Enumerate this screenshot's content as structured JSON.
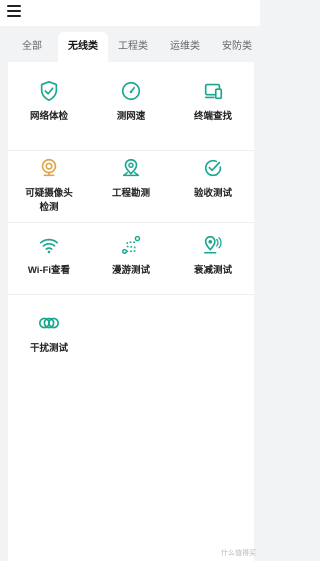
{
  "tabs": [
    {
      "label": "全部",
      "active": false
    },
    {
      "label": "无线类",
      "active": true
    },
    {
      "label": "工程类",
      "active": false
    },
    {
      "label": "运维类",
      "active": false
    },
    {
      "label": "安防类",
      "active": false
    }
  ],
  "tools": [
    {
      "label": "网络体检",
      "icon": "shield-check-icon"
    },
    {
      "label": "测网速",
      "icon": "speedometer-icon"
    },
    {
      "label": "终端查找",
      "icon": "devices-icon"
    },
    {
      "label": "可疑摄像头检测",
      "label_line1": "可疑摄像头",
      "label_line2": "检测",
      "icon": "camera-icon"
    },
    {
      "label": "工程勘测",
      "icon": "map-pin-icon"
    },
    {
      "label": "验收测试",
      "icon": "check-circle-icon"
    },
    {
      "label": "Wi-Fi查看",
      "icon": "wifi-icon"
    },
    {
      "label": "漫游测试",
      "icon": "roaming-path-icon"
    },
    {
      "label": "衰减测试",
      "icon": "signal-attenuation-icon"
    },
    {
      "label": "干扰测试",
      "icon": "interference-rings-icon"
    }
  ],
  "colors": {
    "primary": "#1aa78e",
    "camera": "#e0a34a"
  },
  "watermark": "什么值得买"
}
